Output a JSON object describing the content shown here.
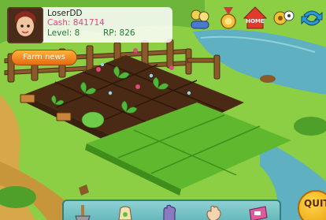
{
  "player": {
    "name": "LoserDD",
    "cash_label": "Cash:",
    "cash": "841714",
    "level_label": "Level:",
    "level": "8",
    "rp_label": "RP:",
    "rp": "826"
  },
  "buttons": {
    "farm_news": "Farm news",
    "home": "HOME",
    "quit": "QUIT"
  },
  "top_icons": [
    "friends-icon",
    "medal-icon",
    "home-icon",
    "settings-icon",
    "refresh-icon"
  ],
  "tools": [
    "hoe-icon",
    "seed-bag-icon",
    "glove-icon",
    "hand-icon",
    "fertilizer-icon"
  ],
  "colors": {
    "grass": "#7cc43a",
    "soil": "#4a2a14",
    "path": "#d6a84a",
    "water": "#5fb0c0",
    "cash_text": "#e0487e",
    "stats_text": "#1f7a30"
  }
}
